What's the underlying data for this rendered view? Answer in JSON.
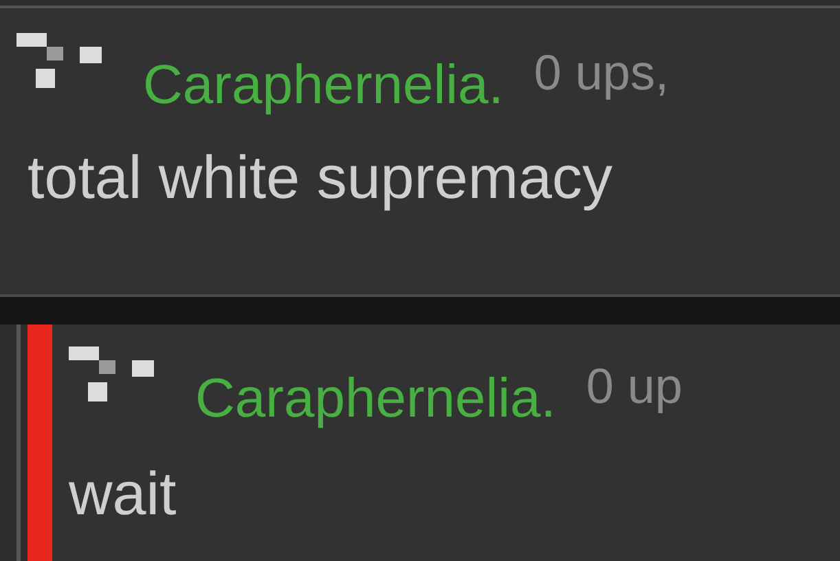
{
  "comments": [
    {
      "username": "Caraphernelia.",
      "points": "0 ups,",
      "text": "total white supremacy",
      "reply": false
    },
    {
      "username": "Caraphernelia.",
      "points": "0 up",
      "text": "wait",
      "reply": true
    }
  ]
}
